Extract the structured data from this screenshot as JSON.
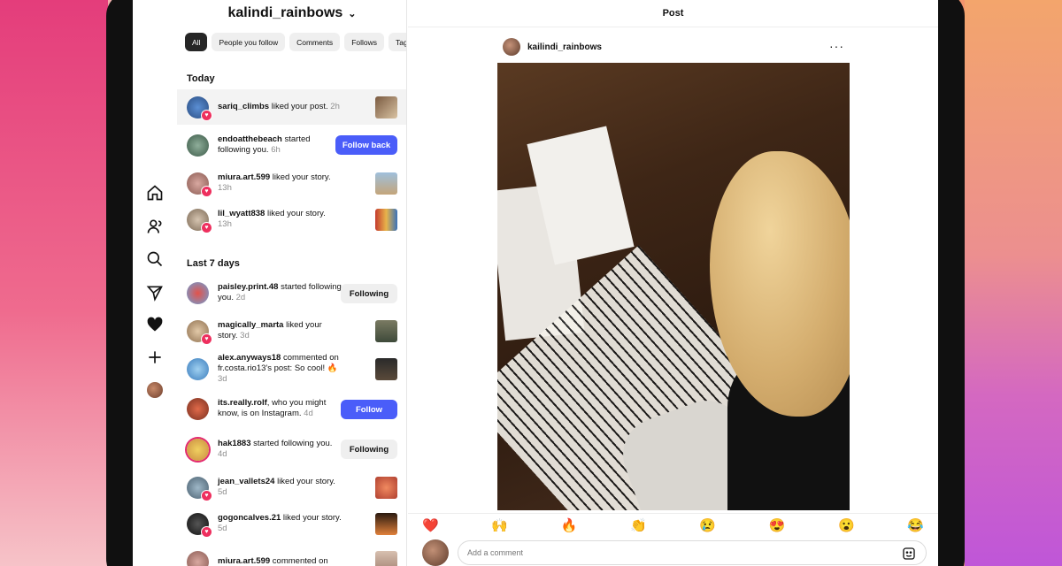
{
  "notifications": {
    "account_name": "kalindi_rainbows",
    "filters": [
      "All",
      "People you follow",
      "Comments",
      "Follows",
      "Tag"
    ],
    "active_filter": "All",
    "sections": {
      "today": "Today",
      "last7": "Last 7 days"
    },
    "items": [
      {
        "user": "sariq_climbs",
        "text": " liked your post.",
        "time": "2h"
      },
      {
        "user": "endoatthebeach",
        "text": " started following you.",
        "time": "6h",
        "button": "Follow back"
      },
      {
        "user": "miura.art.599",
        "text": " liked your story.",
        "time": "13h"
      },
      {
        "user": "lil_wyatt838",
        "text": " liked your story.",
        "time": "13h"
      },
      {
        "user": "paisley.print.48",
        "text": " started following you.",
        "time": "2d",
        "button": "Following"
      },
      {
        "user": "magically_marta",
        "text": " liked your story.",
        "time": "3d"
      },
      {
        "user": "alex.anyways18",
        "text": " commented on fr.costa.rio13's post: So cool! 🔥",
        "time": "3d"
      },
      {
        "user": "its.really.rolf",
        "text": ", who you might know, is on Instagram.",
        "time": "4d",
        "button": "Follow"
      },
      {
        "user": "hak1883",
        "text": " started following you.",
        "time": "4d",
        "button": "Following"
      },
      {
        "user": "jean_vallets24",
        "text": " liked your story.",
        "time": "5d"
      },
      {
        "user": "gogoncalves.21",
        "text": " liked your story.",
        "time": "5d"
      },
      {
        "user": "miura.art.599",
        "text": " commented on",
        "time": ""
      }
    ]
  },
  "post": {
    "header": "Post",
    "author": "kailindi_rainbows",
    "more": "···",
    "reactions": [
      "❤️",
      "🙌",
      "🔥",
      "👏",
      "😢",
      "😍",
      "😮",
      "😂"
    ],
    "comment_placeholder": "Add a comment"
  },
  "nav": {
    "icons": [
      "home-icon",
      "people-icon",
      "search-icon",
      "send-icon",
      "heart-icon",
      "plus-icon",
      "profile-avatar"
    ]
  }
}
